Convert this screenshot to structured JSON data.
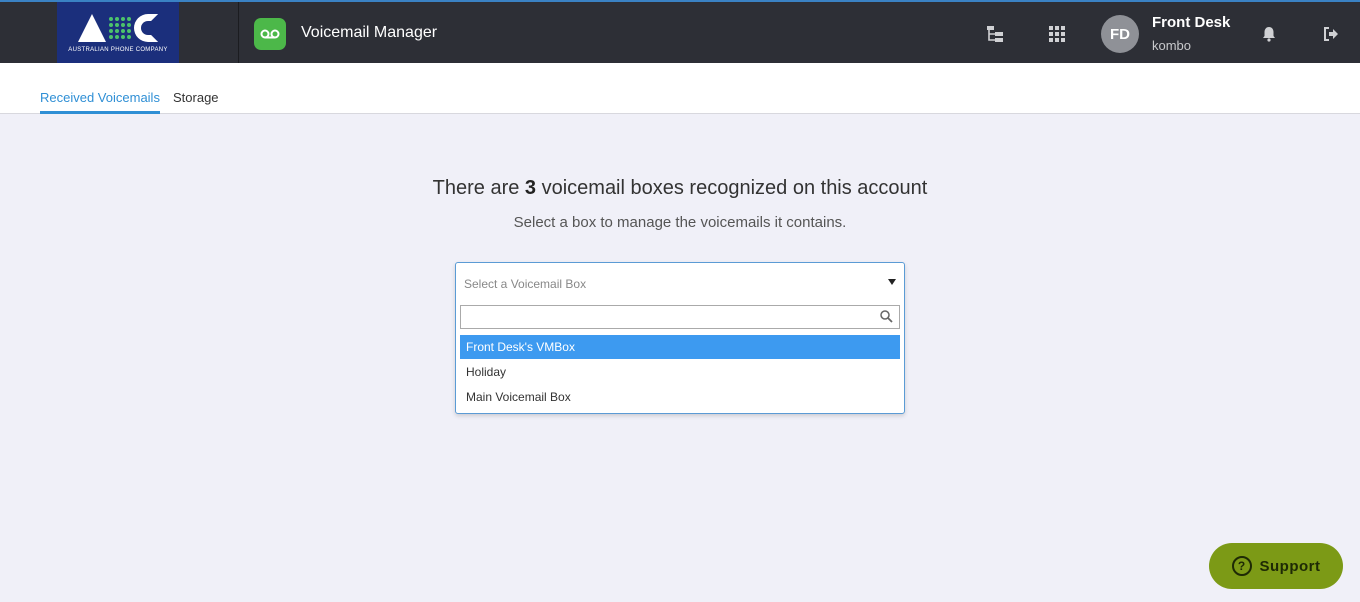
{
  "header": {
    "logo_text": "AUSTRALIAN PHONE COMPANY",
    "app_title": "Voicemail Manager",
    "icons": [
      "hierarchy-icon",
      "apps-grid-icon",
      "bell-icon",
      "logout-icon"
    ],
    "user": {
      "initials": "FD",
      "name": "Front Desk",
      "account": "kombo"
    }
  },
  "tabs": [
    {
      "label": "Received Voicemails",
      "active": true
    },
    {
      "label": "Storage",
      "active": false
    }
  ],
  "main": {
    "heading_prefix": "There are ",
    "box_count": "3",
    "heading_suffix": " voicemail boxes recognized on this account",
    "subheading": "Select a box to manage the voicemails it contains."
  },
  "select": {
    "placeholder": "Select a Voicemail Box",
    "search_value": "",
    "options": [
      "Front Desk's VMBox",
      "Holiday",
      "Main Voicemail Box"
    ],
    "highlighted_index": 0
  },
  "support": {
    "label": "Support"
  },
  "colors": {
    "topbar": "#2d2f36",
    "accent": "#2f8fd5",
    "app_icon": "#4cb849",
    "highlight": "#3d9af0",
    "support": "#7c9a16"
  }
}
